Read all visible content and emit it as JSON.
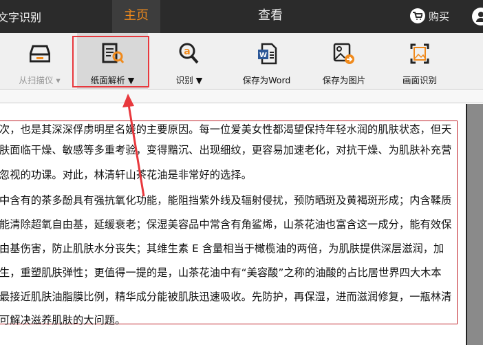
{
  "app": {
    "title": "文字识别"
  },
  "tabs": [
    {
      "label": "主页",
      "active": true
    },
    {
      "label": "查看",
      "active": false
    }
  ],
  "header": {
    "buy_label": "购买"
  },
  "toolbar": {
    "scanner": "从扫描仪 ▾",
    "paper": "纸面解析 ▼",
    "recognize": "识别 ▼",
    "save_word": "保存为Word",
    "save_image": "保存为图片",
    "screen_ocr": "画面识别"
  },
  "document": {
    "lines": [
      "次，也是其深深俘虏明星名媛的主要原因。每一位爱美女性都渴望保持年轻水润的肌肤状态，但天",
      "肤面临干燥、敏感等多重考验，变得黯沉、出现细纹，更容易加速老化，对抗干燥、为肌肤补充营",
      "忽视的功课。对此，林清轩山茶花油是非常好的选择。",
      "中含有的茶多酚具有强抗氧化功能，能阻挡紫外线及辐射侵扰，预防晒斑及黄褐斑形成；内含鞣质",
      "能清除超氧自由基，延缓衰老；保湿美容品中常含有角鲨烯，山茶花油也富含这一成分，能有效保",
      "由基伤害，防止肌肤水分丧失；其维生素 E 含量相当于橄榄油的两倍，为肌肤提供深层滋润，加",
      "生，重塑肌肤弹性；更值得一提的是，山茶花油中有“美容酸”之称的油酸的占比居世界四大木本",
      "最接近肌肤油脂膜比例，精华成分能被肌肤迅速吸收。先防护，再保湿，进而滋润修复，一瓶林清",
      "可解决滋养肌肤的大问题。"
    ]
  },
  "colors": {
    "accent": "#f08a1c",
    "highlight": "#e8383d",
    "topbar": "#2b2b2b"
  }
}
